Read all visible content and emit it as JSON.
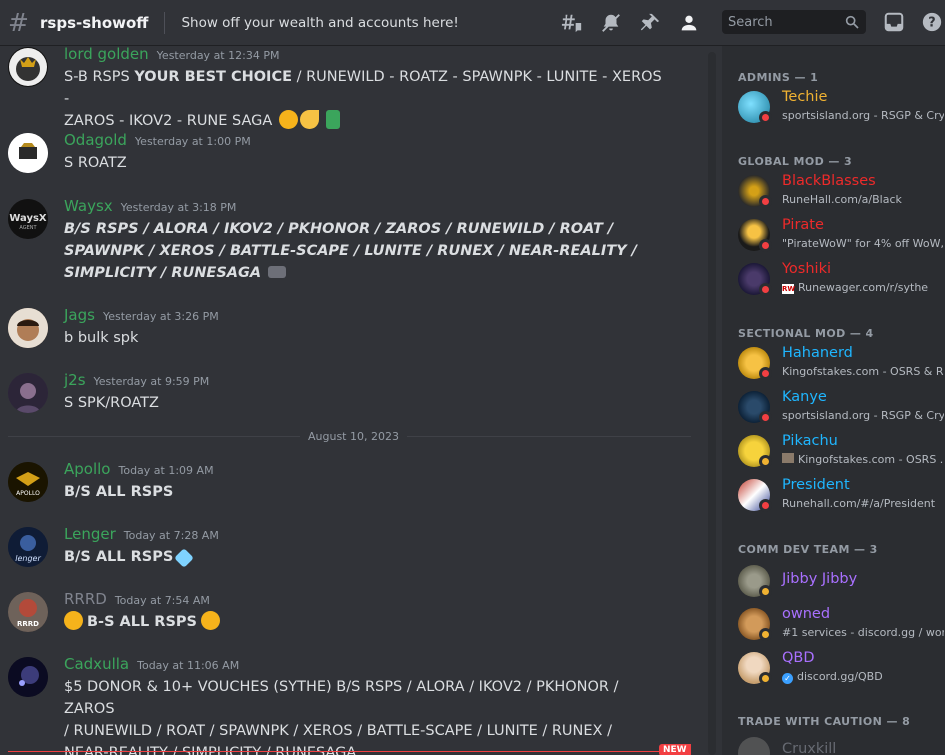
{
  "header": {
    "channel_name": "rsps-showoff",
    "topic": "Show off your wealth and accounts here!",
    "search_placeholder": "Search"
  },
  "messages": [
    {
      "user": "lord golden",
      "time": "Yesterday at 12:34 PM",
      "name_color": "#3ba55c",
      "line1_plain": "S-B RSPS ",
      "line1_bold": " YOUR BEST CHOICE",
      "line1_rest": " / RUNEWILD - ROATZ - SPAWNPK - LUNITE - XEROS -",
      "line2": "ZAROS - IKOV2 - RUNE SAGA "
    },
    {
      "user": "Odagold",
      "time": "Yesterday at 1:00 PM",
      "name_color": "#3ba55c",
      "text": "S ROATZ"
    },
    {
      "user": "Waysx",
      "time": "Yesterday at 3:18 PM",
      "name_color": "#3ba55c",
      "line1": "B/S RSPS / ALORA / IKOV2 / PKHONOR / ZAROS / RUNEWILD / ROAT /",
      "line2": "SPAWNPK / XEROS / BATTLE-SCAPE / LUNITE / RUNEX / NEAR-REALITY /",
      "line3": "SIMPLICITY / RUNESAGA "
    },
    {
      "user": "Jags",
      "time": "Yesterday at 3:26 PM",
      "name_color": "#3ba55c",
      "text": "b bulk spk"
    },
    {
      "user": "j2s",
      "time": "Yesterday at 9:59 PM",
      "name_color": "#3ba55c",
      "text": "S SPK/ROATZ"
    },
    {
      "user": "Apollo",
      "time": "Today at 1:09 AM",
      "name_color": "#3ba55c",
      "text": "B/S ALL RSPS"
    },
    {
      "user": "Lenger",
      "time": "Today at 7:28 AM",
      "name_color": "#3ba55c",
      "text": "B/S ALL RSPS"
    },
    {
      "user": "RRRD",
      "time": "Today at 7:54 AM",
      "name_color": "#80848e",
      "text": "B-S ALL RSPS"
    },
    {
      "user": "Cadxulla",
      "time": "Today at 11:06 AM",
      "name_color": "#3ba55c",
      "line1": "$5 DONOR & 10+ VOUCHES (SYTHE) B/S RSPS / ALORA / IKOV2 / PKHONOR / ZAROS",
      "line2": "/ RUNEWILD / ROAT / SPAWNPK / XEROS / BATTLE-SCAPE / LUNITE / RUNEX /",
      "line3": "NEAR-REALITY / SIMPLICITY / RUNESAGA."
    }
  ],
  "date_divider": "August 10, 2023",
  "new_badge": "NEW",
  "member_groups": [
    {
      "title": "ADMINS — 1",
      "members": [
        {
          "name": "Techie",
          "color": "#f0b232",
          "activity": "sportsisland.org - RSGP & Cry...",
          "status": "dnd"
        }
      ]
    },
    {
      "title": "GLOBAL MOD — 3",
      "members": [
        {
          "name": "BlackBlasses",
          "color": "#ed2a2a",
          "activity": "RuneHall.com/a/Black",
          "status": "dnd"
        },
        {
          "name": "Pirate",
          "color": "#ed2a2a",
          "activity": "\"PirateWoW\" for 4% off WoW, ...",
          "status": "dnd"
        },
        {
          "name": "Yoshiki",
          "color": "#ed2a2a",
          "activity": "Runewager.com/r/sythe",
          "status": "dnd",
          "activity_prefix": "RW"
        }
      ]
    },
    {
      "title": "SECTIONAL MOD — 4",
      "members": [
        {
          "name": "Hahanerd",
          "color": "#1fb6ff",
          "activity": "Kingofstakes.com - OSRS & R...",
          "status": "dnd"
        },
        {
          "name": "Kanye",
          "color": "#1fb6ff",
          "activity": "sportsisland.org - RSGP & Cry...",
          "status": "dnd"
        },
        {
          "name": "Pikachu",
          "color": "#1fb6ff",
          "activity": "Kingofstakes.com - OSRS ...",
          "status": "idle"
        },
        {
          "name": "President",
          "color": "#1fb6ff",
          "activity": "Runehall.com/#/a/President",
          "status": "dnd"
        }
      ]
    },
    {
      "title": "COMM DEV TEAM — 3",
      "members": [
        {
          "name": "Jibby Jibby",
          "color": "#a970ff",
          "activity": "",
          "status": "idle"
        },
        {
          "name": "owned",
          "color": "#a970ff",
          "activity": "#1 services - discord.gg / wor...",
          "status": "idle"
        },
        {
          "name": "QBD",
          "color": "#a970ff",
          "activity": "discord.gg/QBD",
          "status": "idle"
        }
      ]
    },
    {
      "title": "TRADE WITH CAUTION — 8",
      "members": [
        {
          "name": "Cruxkill",
          "color": "#80848e",
          "activity": "",
          "status": "idle"
        }
      ]
    }
  ]
}
